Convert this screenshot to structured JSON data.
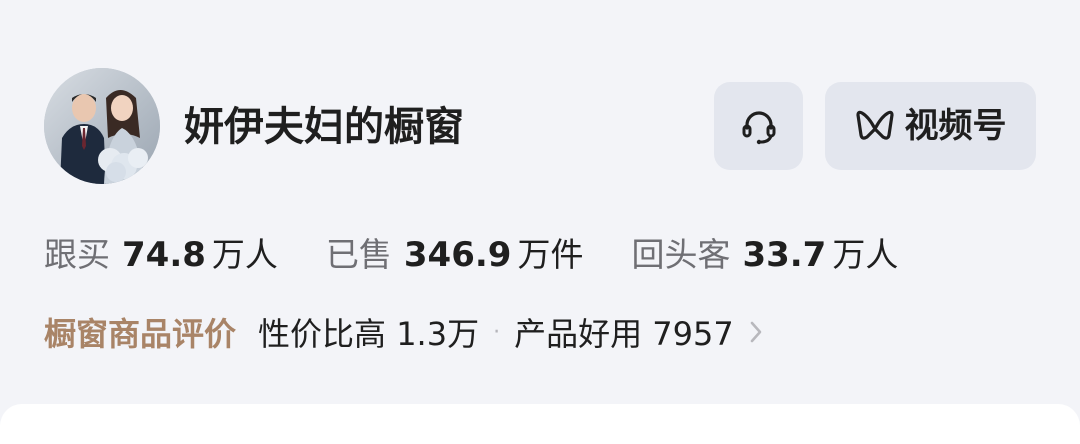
{
  "shop": {
    "name": "妍伊夫妇的橱窗"
  },
  "buttons": {
    "customer_service_icon": "headset-icon",
    "channels_icon": "channels-icon",
    "channels_label": "视频号"
  },
  "stats": [
    {
      "label": "跟买",
      "value": "74.8",
      "unit": "万人"
    },
    {
      "label": "已售",
      "value": "346.9",
      "unit": "万件"
    },
    {
      "label": "回头客",
      "value": "33.7",
      "unit": "万人"
    }
  ],
  "reviews": {
    "title": "橱窗商品评价",
    "tags": [
      "性价比高 1.3万",
      "产品好用 7957"
    ],
    "separator": "·"
  },
  "colors": {
    "background": "#f3f4f8",
    "button_bg": "#e3e6ee",
    "review_title": "#a98467",
    "muted_text": "#6f6f74"
  }
}
